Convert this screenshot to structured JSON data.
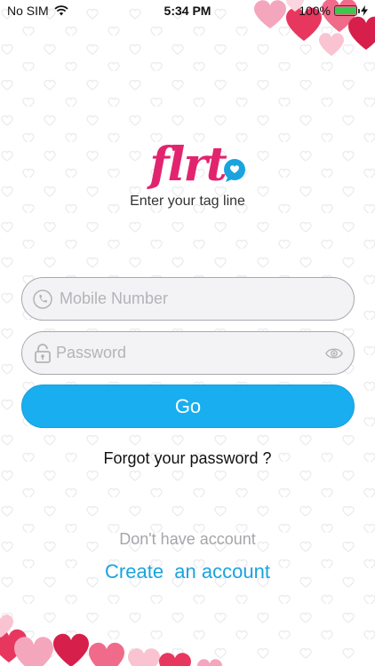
{
  "status_bar": {
    "carrier": "No SIM",
    "time": "5:34 PM",
    "battery": "100%",
    "battery_level": 1.0
  },
  "logo": {
    "wordmark": "flrt",
    "tagline": "Enter your tag line"
  },
  "form": {
    "mobile_placeholder": "Mobile Number",
    "mobile_value": "",
    "password_placeholder": "Password",
    "password_value": "",
    "go_label": "Go"
  },
  "links": {
    "forgot_password": "Forgot your password ?",
    "no_account": "Don't have account",
    "create_account": "Create  an account"
  },
  "colors": {
    "accent": "#18aef0",
    "brand_pink": "#e2246e",
    "link_blue": "#1aa3df"
  },
  "icons": [
    "wifi-icon",
    "battery-icon",
    "charging-icon",
    "phone-icon",
    "lock-icon",
    "eye-icon",
    "chat-heart-icon"
  ]
}
